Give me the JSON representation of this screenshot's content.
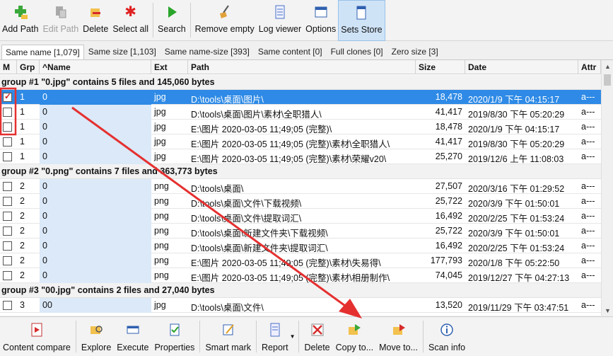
{
  "toolbar": {
    "buttons": [
      {
        "label": "Add Path",
        "icon": "plus-folder-icon",
        "disabled": false
      },
      {
        "label": "Edit Path",
        "icon": "edit-path-icon",
        "disabled": true
      },
      {
        "label": "Delete",
        "icon": "delete-path-icon",
        "disabled": false
      },
      {
        "label": "Select all",
        "icon": "star-icon",
        "disabled": false
      },
      {
        "label": "Search",
        "icon": "play-icon",
        "disabled": false
      },
      {
        "label": "Remove empty",
        "icon": "broom-icon",
        "disabled": false
      },
      {
        "label": "Log viewer",
        "icon": "log-icon",
        "disabled": false
      },
      {
        "label": "Options",
        "icon": "window-icon",
        "disabled": false
      },
      {
        "label": "Sets Store",
        "icon": "document-icon",
        "disabled": false
      }
    ]
  },
  "tabs": [
    "Same name [1,079]",
    "Same size [1,103]",
    "Same name-size [393]",
    "Same content [0]",
    "Full clones [0]",
    "Zero size [3]"
  ],
  "columns": {
    "m": "M",
    "grp": "Grp",
    "name": "^Name",
    "ext": "Ext",
    "path": "Path",
    "size": "Size",
    "date": "Date",
    "attr": "Attr"
  },
  "groups": [
    {
      "title": "group #1 \"0.jpg\" contains 5 files and 145,060 bytes",
      "rows": [
        {
          "checked": true,
          "grp": "1",
          "name": "0",
          "ext": "jpg",
          "path": "D:\\tools\\桌面\\图片\\",
          "size": "18,478",
          "date": "2020/1/9 下午 04:15:17",
          "attr": "a---",
          "selected": true
        },
        {
          "checked": false,
          "grp": "1",
          "name": "0",
          "ext": "jpg",
          "path": "D:\\tools\\桌面\\图片\\素材\\全职猎人\\",
          "size": "41,417",
          "date": "2019/8/30 下午 05:20:29",
          "attr": "a---",
          "selected": false
        },
        {
          "checked": false,
          "grp": "1",
          "name": "0",
          "ext": "jpg",
          "path": "E:\\图片 2020-03-05 11;49;05 (完整)\\",
          "size": "18,478",
          "date": "2020/1/9 下午 04:15:17",
          "attr": "a---",
          "selected": false
        },
        {
          "checked": false,
          "grp": "1",
          "name": "0",
          "ext": "jpg",
          "path": "E:\\图片 2020-03-05 11;49;05 (完整)\\素材\\全职猎人\\",
          "size": "41,417",
          "date": "2019/8/30 下午 05:20:29",
          "attr": "a---",
          "selected": false
        },
        {
          "checked": false,
          "grp": "1",
          "name": "0",
          "ext": "jpg",
          "path": "E:\\图片 2020-03-05 11;49;05 (完整)\\素材\\荣耀v20\\",
          "size": "25,270",
          "date": "2019/12/6 上午 11:08:03",
          "attr": "a---",
          "selected": false
        }
      ]
    },
    {
      "title": "group #2 \"0.png\" contains 7 files and 363,773 bytes",
      "rows": [
        {
          "checked": false,
          "grp": "2",
          "name": "0",
          "ext": "png",
          "path": "D:\\tools\\桌面\\",
          "size": "27,507",
          "date": "2020/3/16 下午 01:29:52",
          "attr": "a---",
          "selected": false
        },
        {
          "checked": false,
          "grp": "2",
          "name": "0",
          "ext": "png",
          "path": "D:\\tools\\桌面\\文件\\下载视频\\",
          "size": "25,722",
          "date": "2020/3/9 下午 01:50:01",
          "attr": "a---",
          "selected": false
        },
        {
          "checked": false,
          "grp": "2",
          "name": "0",
          "ext": "png",
          "path": "D:\\tools\\桌面\\文件\\提取词汇\\",
          "size": "16,492",
          "date": "2020/2/25 下午 01:53:24",
          "attr": "a---",
          "selected": false
        },
        {
          "checked": false,
          "grp": "2",
          "name": "0",
          "ext": "png",
          "path": "D:\\tools\\桌面\\新建文件夹\\下载视频\\",
          "size": "25,722",
          "date": "2020/3/9 下午 01:50:01",
          "attr": "a---",
          "selected": false
        },
        {
          "checked": false,
          "grp": "2",
          "name": "0",
          "ext": "png",
          "path": "D:\\tools\\桌面\\新建文件夹\\提取词汇\\",
          "size": "16,492",
          "date": "2020/2/25 下午 01:53:24",
          "attr": "a---",
          "selected": false
        },
        {
          "checked": false,
          "grp": "2",
          "name": "0",
          "ext": "png",
          "path": "E:\\图片 2020-03-05 11;49;05 (完整)\\素材\\失易得\\",
          "size": "177,793",
          "date": "2020/1/8 下午 05:22:50",
          "attr": "a---",
          "selected": false
        },
        {
          "checked": false,
          "grp": "2",
          "name": "0",
          "ext": "png",
          "path": "E:\\图片 2020-03-05 11;49;05 (完整)\\素材\\相册制作\\",
          "size": "74,045",
          "date": "2019/12/27 下午 04:27:13",
          "attr": "a---",
          "selected": false
        }
      ]
    },
    {
      "title": "group #3 \"00.jpg\" contains 2 files and 27,040 bytes",
      "rows": [
        {
          "checked": false,
          "grp": "3",
          "name": "00",
          "ext": "jpg",
          "path": "D:\\tools\\桌面\\文件\\",
          "size": "13,520",
          "date": "2019/11/29 下午 03:47:51",
          "attr": "a---",
          "selected": false
        }
      ]
    }
  ],
  "bottombar": {
    "buttons": [
      {
        "label": "Content compare",
        "icon": "compare-icon"
      },
      {
        "label": "Explore",
        "icon": "explore-icon"
      },
      {
        "label": "Execute",
        "icon": "execute-icon"
      },
      {
        "label": "Properties",
        "icon": "properties-icon"
      },
      {
        "label": "Smart mark",
        "icon": "smart-mark-icon"
      },
      {
        "label": "Report",
        "icon": "report-icon"
      },
      {
        "label": "Delete",
        "icon": "delete-x-icon"
      },
      {
        "label": "Copy to...",
        "icon": "copy-to-icon"
      },
      {
        "label": "Move to...",
        "icon": "move-to-icon"
      },
      {
        "label": "Scan info",
        "icon": "info-icon"
      }
    ]
  },
  "colors": {
    "selected_row": "#2e8ae6",
    "name_col_bg": "#dbe9f8",
    "annotation": "#e53030"
  }
}
